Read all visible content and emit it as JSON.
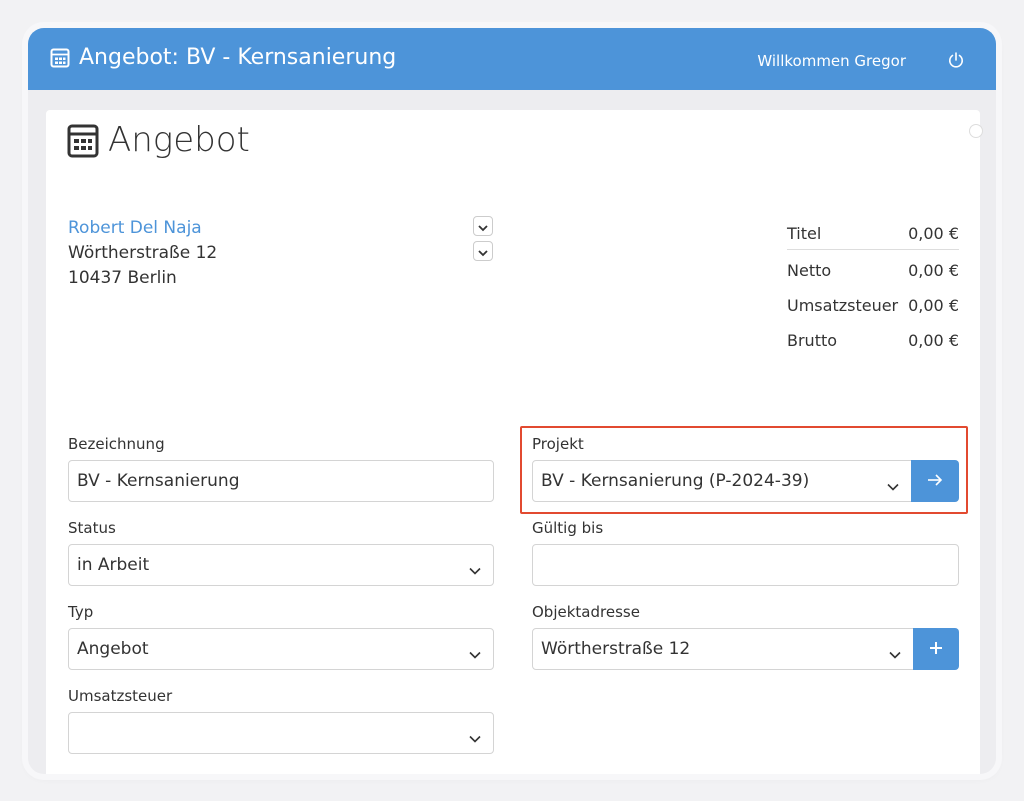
{
  "header": {
    "title": "Angebot: BV - Kernsanierung",
    "welcome": "Willkommen Gregor",
    "app_icon": "calculator-icon",
    "logout_icon": "power-icon"
  },
  "page": {
    "title": "Angebot",
    "icon": "calculator-icon"
  },
  "customer": {
    "name": "Robert Del Naja",
    "street": "Wörtherstraße 12",
    "city": "10437 Berlin"
  },
  "totals": [
    {
      "label": "Titel",
      "value": "0,00 €"
    },
    {
      "label": "Netto",
      "value": "0,00 €"
    },
    {
      "label": "Umsatzsteuer",
      "value": "0,00 €"
    },
    {
      "label": "Brutto",
      "value": "0,00 €"
    }
  ],
  "form": {
    "bezeichnung": {
      "label": "Bezeichnung",
      "value": "BV - Kernsanierung"
    },
    "status": {
      "label": "Status",
      "value": "in Arbeit"
    },
    "typ": {
      "label": "Typ",
      "value": "Angebot"
    },
    "umsatzsteuer": {
      "label": "Umsatzsteuer",
      "value": ""
    },
    "projekt": {
      "label": "Projekt",
      "value": "BV - Kernsanierung (P-2024-39)"
    },
    "gueltig_bis": {
      "label": "Gültig bis",
      "value": ""
    },
    "objektadresse": {
      "label": "Objektadresse",
      "value": "Wörtherstraße 12"
    }
  },
  "colors": {
    "primary": "#4d94d9",
    "highlight": "#e24a30"
  }
}
